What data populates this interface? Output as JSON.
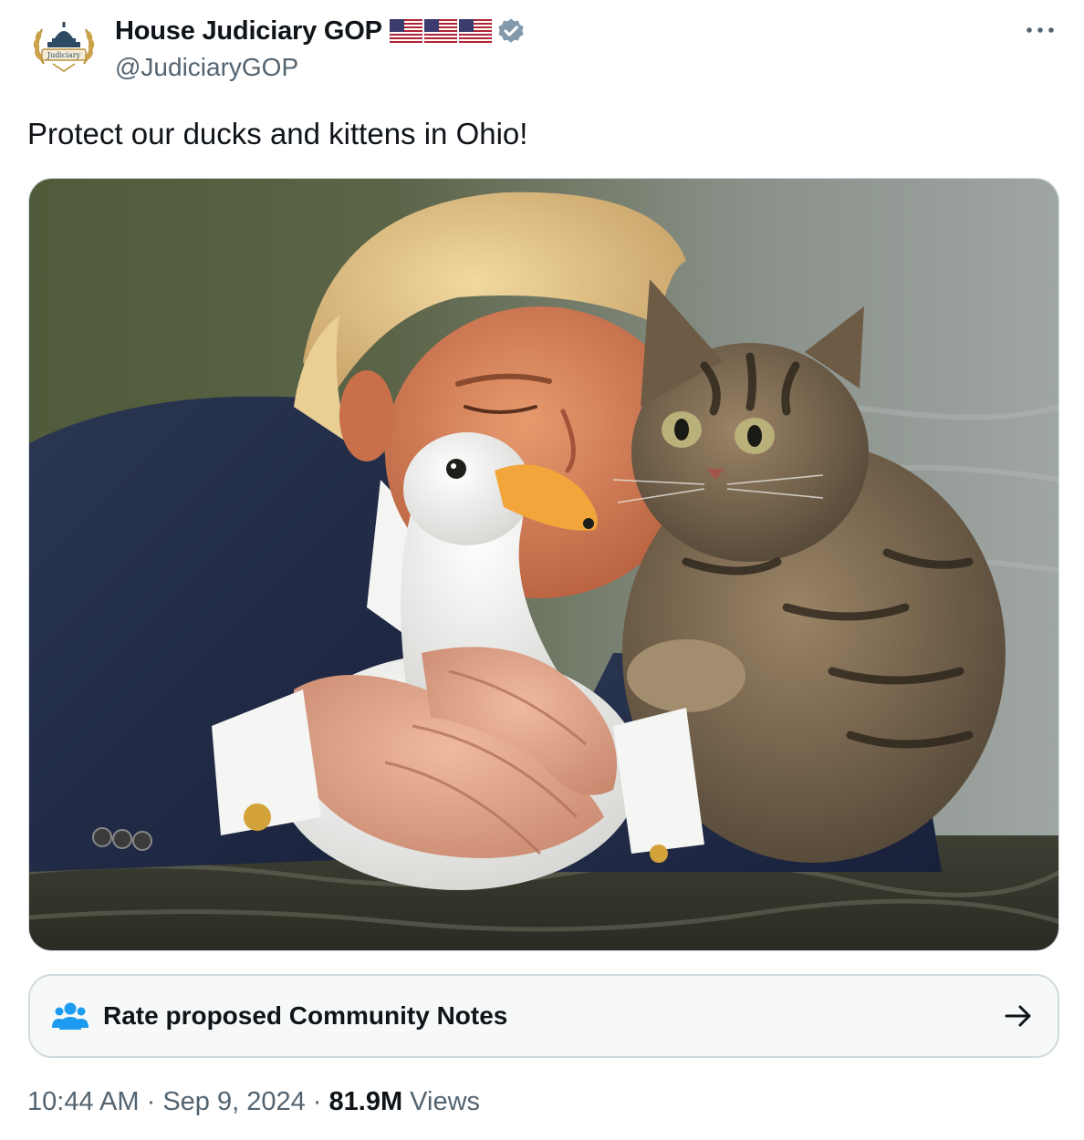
{
  "author": {
    "display_name": "House Judiciary GOP",
    "handle": "@JudiciaryGOP",
    "avatar_icon": "house-judiciary-seal-icon",
    "avatar_seal_text": "Judiciary",
    "flags": [
      "us-flag-icon",
      "us-flag-icon",
      "us-flag-icon"
    ],
    "verified_icon": "verified-badge-icon"
  },
  "more_icon": "more-dots-icon",
  "tweet": {
    "text": "Protect our ducks and kittens in Ohio!"
  },
  "community_notes": {
    "label": "Rate proposed Community Notes",
    "icon": "people-group-icon",
    "arrow_icon": "arrow-right-icon"
  },
  "meta": {
    "time": "10:44 AM",
    "separator": " · ",
    "date": "Sep 9, 2024",
    "views_count": "81.9M",
    "views_label": " Views"
  },
  "colors": {
    "text_primary": "#0f1419",
    "text_secondary": "#536471",
    "border": "#cfd9de",
    "notes_icon": "#1d9bf0",
    "verified_badge": "#829aab"
  }
}
